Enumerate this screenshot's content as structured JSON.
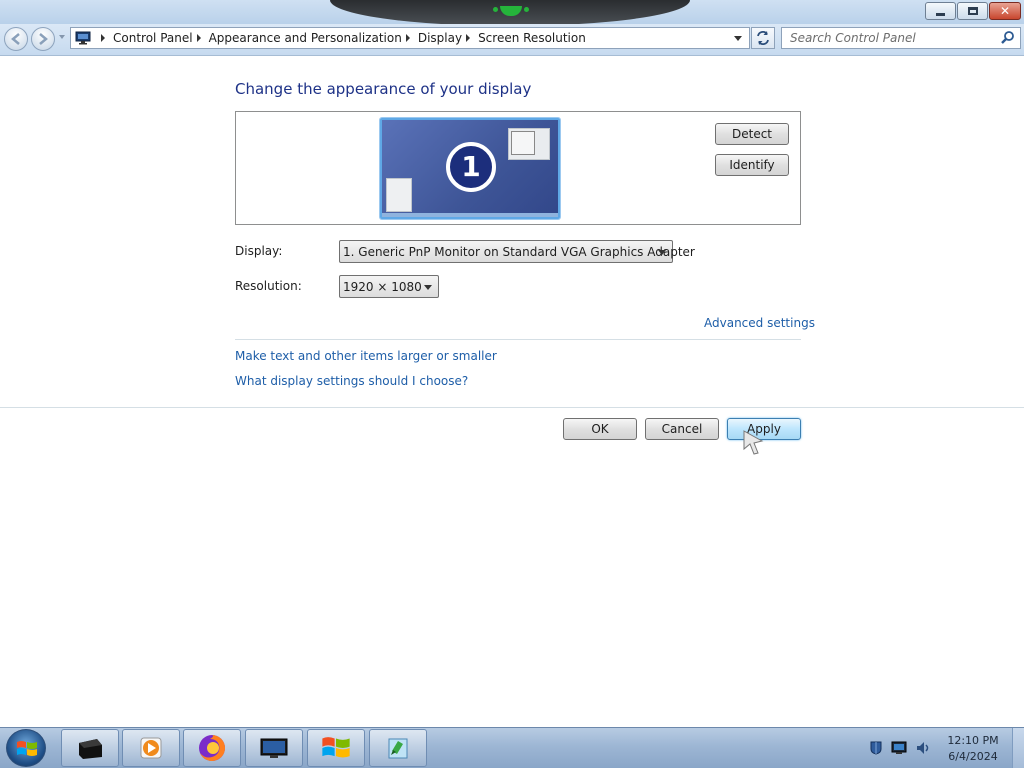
{
  "window": {
    "buttons": {
      "minimize": "minimize",
      "maximize": "maximize",
      "close": "✕"
    }
  },
  "navigation": {
    "breadcrumbs": [
      "Control Panel",
      "Appearance and Personalization",
      "Display",
      "Screen Resolution"
    ],
    "search_placeholder": "Search Control Panel"
  },
  "page": {
    "title": "Change the appearance of your display",
    "monitor_number": "1",
    "detect_label": "Detect",
    "identify_label": "Identify",
    "display_label": "Display:",
    "display_value": "1. Generic PnP Monitor on Standard VGA Graphics Adapter",
    "resolution_label": "Resolution:",
    "resolution_value": "1920 × 1080",
    "advanced_link": "Advanced settings",
    "larger_link": "Make text and other items larger or smaller",
    "which_link": "What display settings should I choose?",
    "ok_label": "OK",
    "cancel_label": "Cancel",
    "apply_label": "Apply"
  },
  "taskbar": {
    "items": [
      "terminal-icon",
      "media-player-icon",
      "firefox-icon",
      "display-settings-icon",
      "windows-explorer-icon",
      "notepad-icon"
    ],
    "tray": [
      "action-center-icon",
      "network-icon",
      "volume-icon"
    ],
    "time": "12:10 PM",
    "date": "6/4/2024"
  },
  "colors": {
    "title": "#1e3287",
    "link": "#1e5ea8",
    "monitor_badge": "#1c2e7c",
    "apply_highlight": "#bee6fd"
  }
}
